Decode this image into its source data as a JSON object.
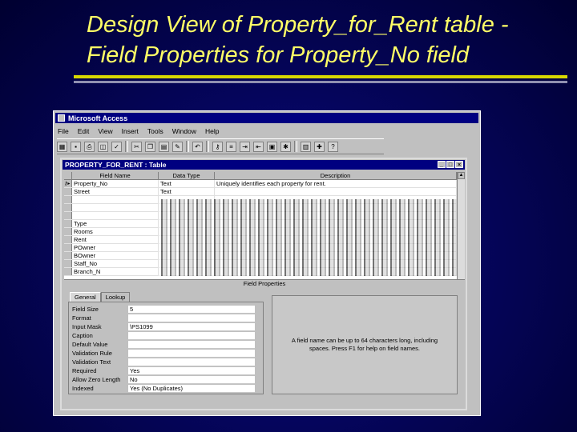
{
  "slide": {
    "title_line1": "Design View of Property_for_Rent table -",
    "title_line2": "Field Properties for Property_No field"
  },
  "app": {
    "title": "Microsoft Access",
    "menu": [
      "File",
      "Edit",
      "View",
      "Insert",
      "Tools",
      "Window",
      "Help"
    ]
  },
  "table_window": {
    "title": "PROPERTY_FOR_RENT : Table",
    "columns": [
      "Field Name",
      "Data Type",
      "Description"
    ],
    "rows": [
      {
        "field": "Property_No",
        "type": "Text",
        "desc": "Uniquely identifies each property for rent."
      },
      {
        "field": "Street",
        "type": "Text",
        "desc": ""
      },
      {
        "field": "",
        "type": "",
        "desc": ""
      },
      {
        "field": "",
        "type": "",
        "desc": ""
      },
      {
        "field": "",
        "type": "",
        "desc": ""
      },
      {
        "field": "Type",
        "type": "",
        "desc": ""
      },
      {
        "field": "Rooms",
        "type": "",
        "desc": ""
      },
      {
        "field": "Rent",
        "type": "",
        "desc": ""
      },
      {
        "field": "POwner",
        "type": "",
        "desc": ""
      },
      {
        "field": "BOwner",
        "type": "",
        "desc": ""
      },
      {
        "field": "Staff_No",
        "type": "",
        "desc": ""
      },
      {
        "field": "Branch_N",
        "type": "",
        "desc": ""
      }
    ],
    "field_properties_label": "Field Properties",
    "tabs": [
      "General",
      "Lookup"
    ],
    "properties": [
      {
        "label": "Field Size",
        "value": "5"
      },
      {
        "label": "Format",
        "value": ""
      },
      {
        "label": "Input Mask",
        "value": "\\PS1099"
      },
      {
        "label": "Caption",
        "value": ""
      },
      {
        "label": "Default Value",
        "value": ""
      },
      {
        "label": "Validation Rule",
        "value": ""
      },
      {
        "label": "Validation Text",
        "value": ""
      },
      {
        "label": "Required",
        "value": "Yes"
      },
      {
        "label": "Allow Zero Length",
        "value": "No"
      },
      {
        "label": "Indexed",
        "value": "Yes (No Duplicates)"
      }
    ],
    "help_text": "A field name can be up to 64 characters long, including spaces. Press F1 for help on field names."
  }
}
